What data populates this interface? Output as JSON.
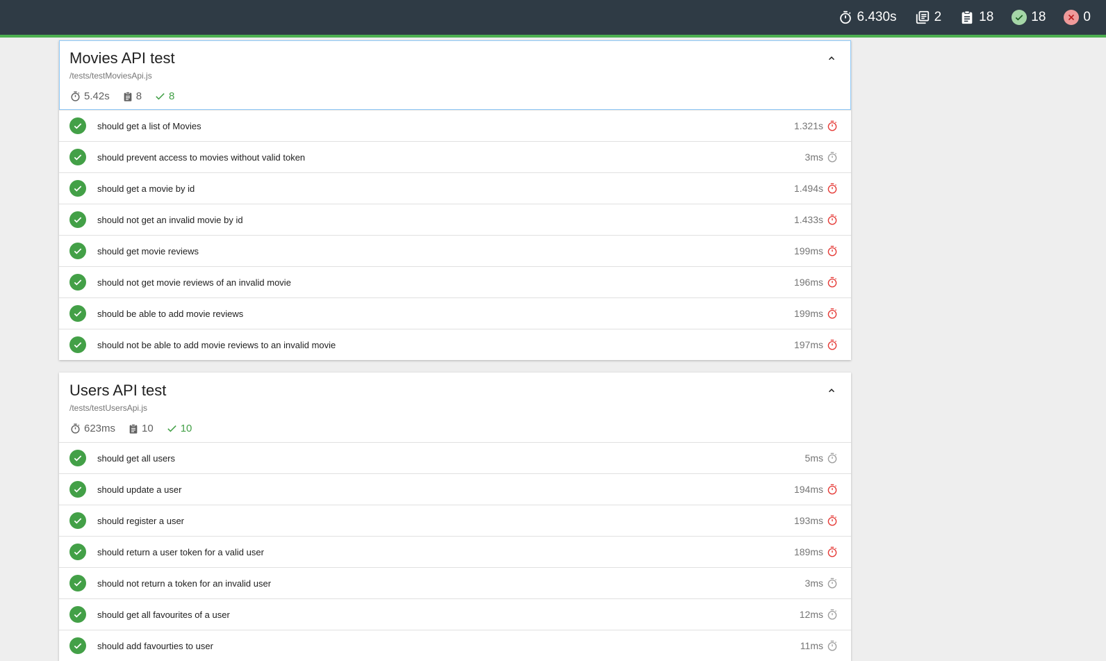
{
  "topbar": {
    "duration": "6.430s",
    "suites": "2",
    "tests": "18",
    "passes": "18",
    "failures": "0"
  },
  "colors": {
    "pass": "#43a047",
    "slow": "#e53935",
    "fast": "#9e9e9e",
    "header": "#2f3b45",
    "accent": "#4caf50"
  },
  "suites": [
    {
      "title": "Movies API test",
      "file": "/tests/testMoviesApi.js",
      "duration": "5.42s",
      "tests_count": "8",
      "passes": "8",
      "tests": [
        {
          "title": "should get a list of Movies",
          "duration": "1.321s",
          "speed": "slow"
        },
        {
          "title": "should prevent access to movies without valid token",
          "duration": "3ms",
          "speed": "fast"
        },
        {
          "title": "should get a movie by id",
          "duration": "1.494s",
          "speed": "slow"
        },
        {
          "title": "should not get an invalid movie by id",
          "duration": "1.433s",
          "speed": "slow"
        },
        {
          "title": "should get movie reviews",
          "duration": "199ms",
          "speed": "slow"
        },
        {
          "title": "should not get movie reviews of an invalid movie",
          "duration": "196ms",
          "speed": "slow"
        },
        {
          "title": "should be able to add movie reviews",
          "duration": "199ms",
          "speed": "slow"
        },
        {
          "title": "should not be able to add movie reviews to an invalid movie",
          "duration": "197ms",
          "speed": "slow"
        }
      ]
    },
    {
      "title": "Users API test",
      "file": "/tests/testUsersApi.js",
      "duration": "623ms",
      "tests_count": "10",
      "passes": "10",
      "tests": [
        {
          "title": "should get all users",
          "duration": "5ms",
          "speed": "fast"
        },
        {
          "title": "should update a user",
          "duration": "194ms",
          "speed": "slow"
        },
        {
          "title": "should register a user",
          "duration": "193ms",
          "speed": "slow"
        },
        {
          "title": "should return a user token for a valid user",
          "duration": "189ms",
          "speed": "slow"
        },
        {
          "title": "should not return a token for an invalid user",
          "duration": "3ms",
          "speed": "fast"
        },
        {
          "title": "should get all favourites of a user",
          "duration": "12ms",
          "speed": "fast"
        },
        {
          "title": "should add favourties to user",
          "duration": "11ms",
          "speed": "fast"
        }
      ]
    }
  ]
}
